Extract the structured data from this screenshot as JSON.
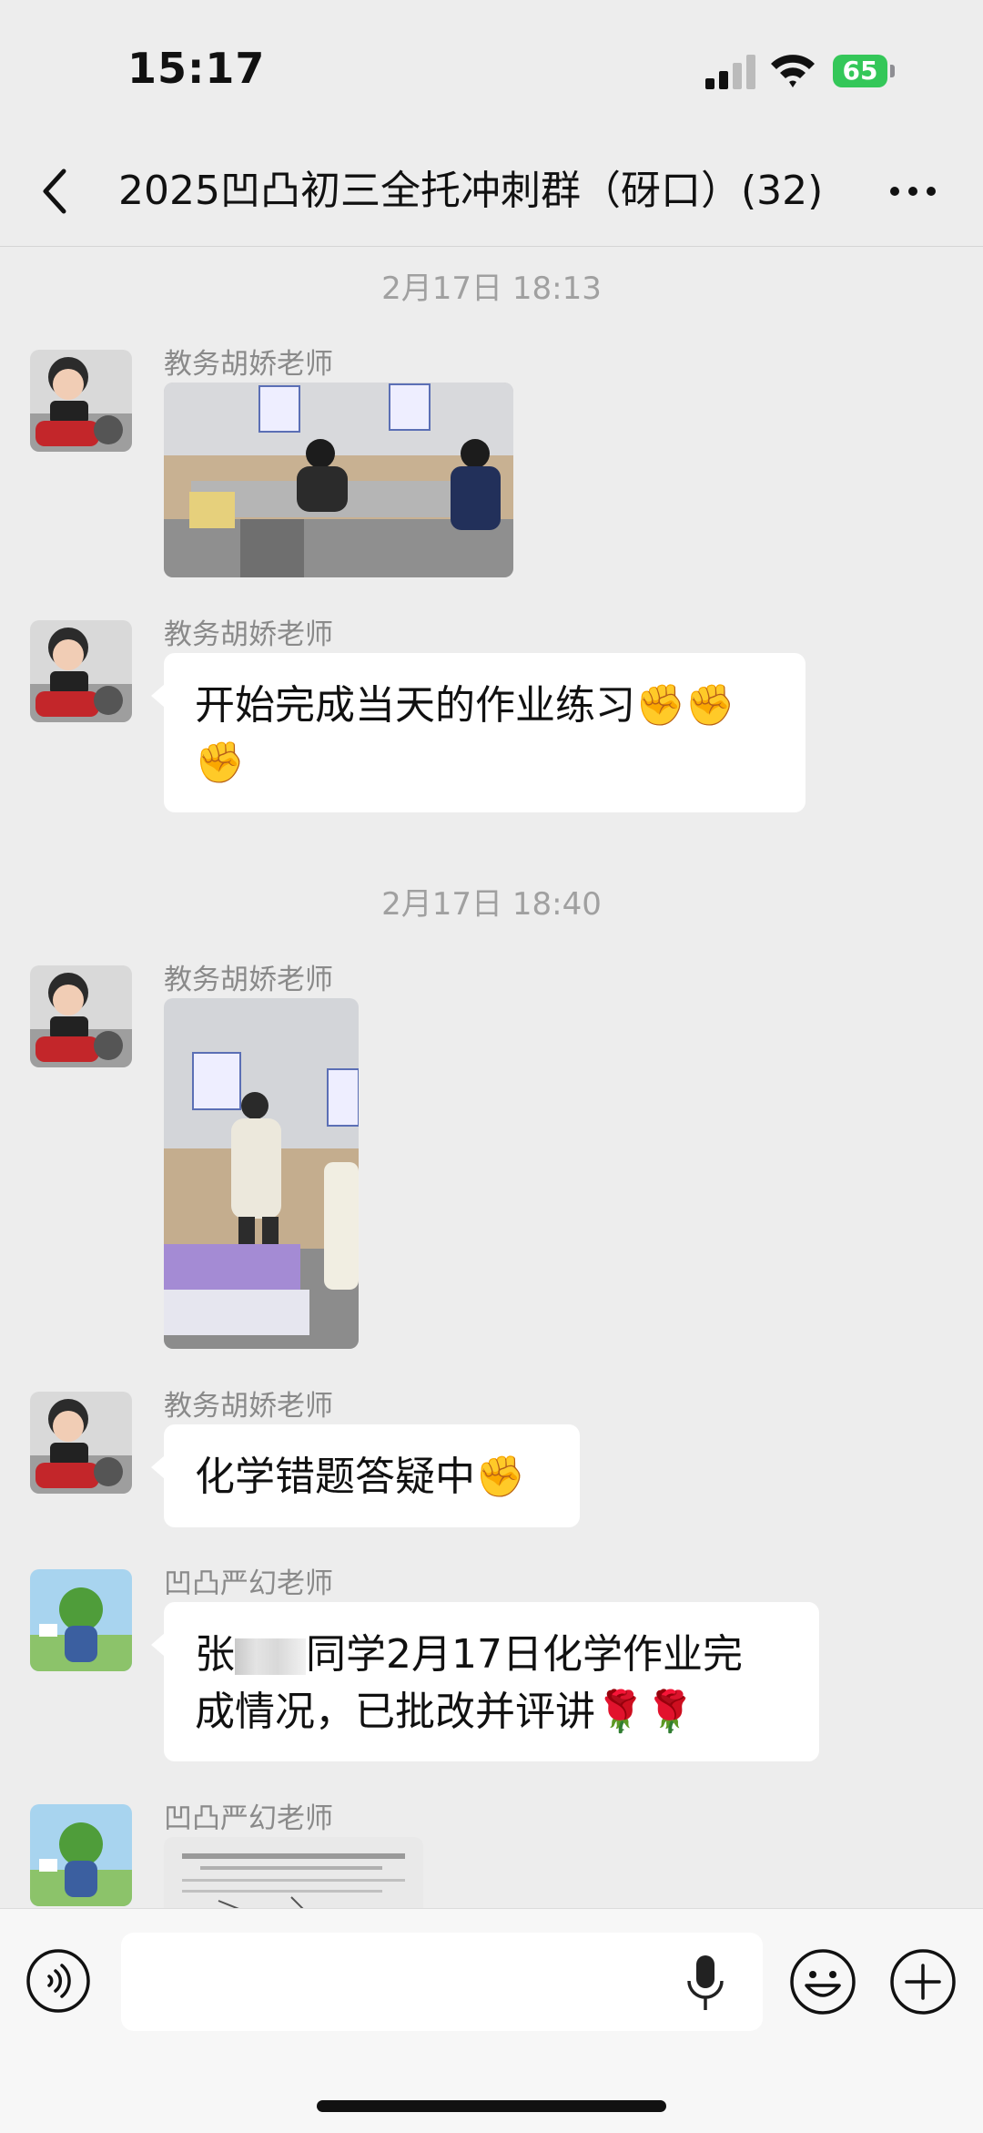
{
  "status_bar": {
    "time": "15:17",
    "battery": "65"
  },
  "header": {
    "title": "2025凹凸初三全托冲刺群（砑口）(32)"
  },
  "messages": [
    {
      "type": "timestamp",
      "text": "2月17日 18:13"
    },
    {
      "type": "image",
      "sender": "教务胡娇老师"
    },
    {
      "type": "text",
      "sender": "教务胡娇老师",
      "line1": "开始完成当天的作业练习✊✊",
      "line2": "✊"
    },
    {
      "type": "timestamp",
      "text": "2月17日 18:40"
    },
    {
      "type": "image",
      "sender": "教务胡娇老师"
    },
    {
      "type": "text",
      "sender": "教务胡娇老师",
      "text": "化学错题答疑中✊"
    },
    {
      "type": "text",
      "sender": "凹凸严幻老师",
      "prefix": "张",
      "rest_line1": "同学2月17日化学作业完",
      "line2": "成情况，已批改并评讲🌹🌹"
    },
    {
      "type": "image",
      "sender": "凹凸严幻老师"
    }
  ],
  "input": {
    "placeholder": ""
  },
  "colors": {
    "background": "#ededed",
    "bubble": "#ffffff",
    "battery": "#34c759",
    "timestamp": "#a0a0a0"
  },
  "icons": [
    "back-arrow-icon",
    "more-dots-icon",
    "voice-icon",
    "microphone-icon",
    "emoji-icon",
    "plus-icon",
    "signal-icon",
    "wifi-icon",
    "battery-icon"
  ]
}
